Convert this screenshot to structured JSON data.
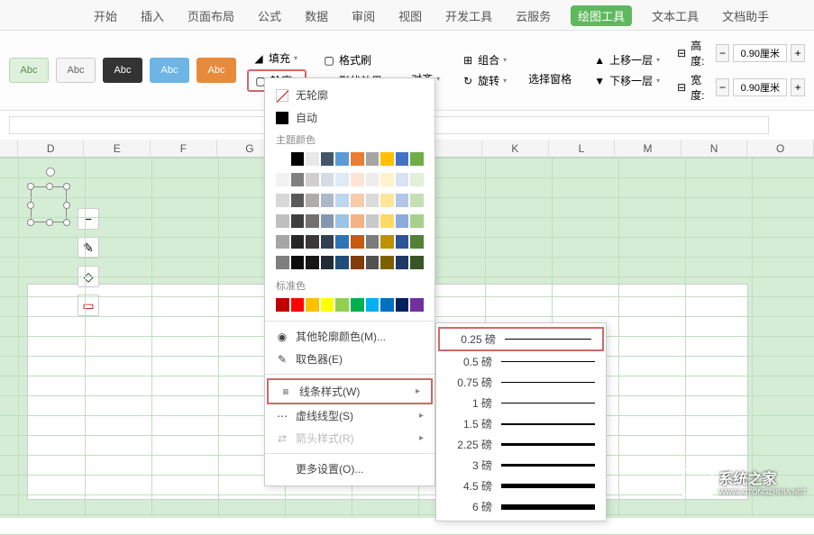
{
  "tabs": [
    "开始",
    "插入",
    "页面布局",
    "公式",
    "数据",
    "审阅",
    "视图",
    "开发工具",
    "云服务",
    "绘图工具",
    "文本工具",
    "文档助手"
  ],
  "active_tab_index": 9,
  "presets": [
    "Abc",
    "Abc",
    "Abc",
    "Abc",
    "Abc"
  ],
  "ribbon": {
    "fill": "填充",
    "format_painter": "格式刷",
    "outline": "轮廓",
    "shape_effects": "形状效果",
    "align": "对齐",
    "group": "组合",
    "rotate": "旋转",
    "selection_pane": "选择窗格",
    "bring_forward": "上移一层",
    "send_backward": "下移一层",
    "height_label": "高度:",
    "width_label": "宽度:",
    "height_value": "0.90厘米",
    "width_value": "0.90厘米"
  },
  "columns": [
    "D",
    "E",
    "F",
    "G",
    "",
    "",
    "",
    "K",
    "L",
    "M",
    "N",
    "O"
  ],
  "panel": {
    "no_outline": "无轮廓",
    "auto": "自动",
    "theme_colors": "主题颜色",
    "standard_colors": "标准色",
    "more_colors": "其他轮廓颜色(M)...",
    "eyedropper": "取色器(E)",
    "line_style": "线条样式(W)",
    "dash_type": "虚线线型(S)",
    "arrow_style": "箭头样式(R)",
    "more_settings": "更多设置(O)..."
  },
  "theme_colors_rows": [
    [
      "#ffffff",
      "#000000",
      "#e8e8e8",
      "#445569",
      "#5b9bd5",
      "#ed7d31",
      "#a5a5a5",
      "#ffc000",
      "#4472c4",
      "#70ad47"
    ],
    [
      "#f2f2f2",
      "#7f7f7f",
      "#d0cece",
      "#d6dce4",
      "#deebf6",
      "#fce5d5",
      "#ededed",
      "#fff2cc",
      "#d9e2f3",
      "#e2efd9"
    ],
    [
      "#d8d8d8",
      "#595959",
      "#aeabab",
      "#adb9ca",
      "#bdd7ee",
      "#f7cbac",
      "#dbdbdb",
      "#fee599",
      "#b4c6e7",
      "#c5e0b3"
    ],
    [
      "#bfbfbf",
      "#3f3f3f",
      "#757070",
      "#8496b0",
      "#9cc3e5",
      "#f4b183",
      "#c9c9c9",
      "#ffd965",
      "#8eaadb",
      "#a8d08d"
    ],
    [
      "#a5a5a5",
      "#262626",
      "#3a3838",
      "#323f4f",
      "#2e75b5",
      "#c55a11",
      "#7b7b7b",
      "#bf9000",
      "#2f5496",
      "#538135"
    ],
    [
      "#7f7f7f",
      "#0c0c0c",
      "#171616",
      "#222a35",
      "#1e4e79",
      "#833c0b",
      "#525252",
      "#7f6000",
      "#1f3864",
      "#375623"
    ]
  ],
  "standard_colors": [
    "#c00000",
    "#ff0000",
    "#ffc000",
    "#ffff00",
    "#92d050",
    "#00b050",
    "#00b0f0",
    "#0070c0",
    "#002060",
    "#7030a0"
  ],
  "line_weights": [
    {
      "label": "0.25 磅",
      "h": 1
    },
    {
      "label": "0.5 磅",
      "h": 1
    },
    {
      "label": "0.75 磅",
      "h": 1
    },
    {
      "label": "1 磅",
      "h": 1.5
    },
    {
      "label": "1.5 磅",
      "h": 2
    },
    {
      "label": "2.25 磅",
      "h": 2.5
    },
    {
      "label": "3 磅",
      "h": 3
    },
    {
      "label": "4.5 磅",
      "h": 4.5
    },
    {
      "label": "6 磅",
      "h": 6
    }
  ],
  "watermark": {
    "text": "系统之家",
    "url": "WWW.XITONGZHIJIA.NET"
  }
}
